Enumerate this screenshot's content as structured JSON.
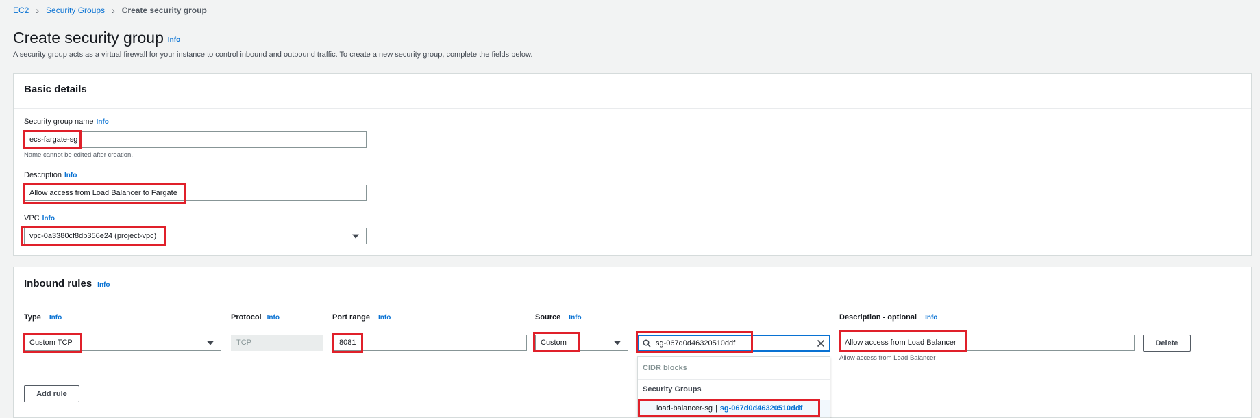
{
  "breadcrumb": {
    "items": [
      "EC2",
      "Security Groups"
    ],
    "current": "Create security group"
  },
  "page": {
    "title": "Create security group",
    "info": "Info",
    "description": "A security group acts as a virtual firewall for your instance to control inbound and outbound traffic. To create a new security group, complete the fields below."
  },
  "basic": {
    "title": "Basic details",
    "name_label": "Security group name",
    "name_value": "ecs-fargate-sg",
    "name_hint": "Name cannot be edited after creation.",
    "desc_label": "Description",
    "desc_value": "Allow access from Load Balancer to Fargate",
    "vpc_label": "VPC",
    "vpc_value": "vpc-0a3380cf8db356e24 (project-vpc)",
    "info": "Info"
  },
  "inbound": {
    "title": "Inbound rules",
    "info": "Info",
    "columns": {
      "type": "Type",
      "protocol": "Protocol",
      "port": "Port range",
      "source": "Source",
      "desc": "Description - optional"
    },
    "rule": {
      "type": "Custom TCP",
      "protocol": "TCP",
      "port": "8081",
      "source": "Custom",
      "search": "sg-067d0d46320510ddf",
      "desc": "Allow access from Load Balancer",
      "desc_hint": "Allow access from Load Balancer"
    },
    "delete_label": "Delete",
    "add_rule_label": "Add rule",
    "dropdown": {
      "cidr_header": "CIDR blocks",
      "sg_header": "Security Groups",
      "option_name": "load-balancer-sg",
      "option_sep": "|",
      "option_id": "sg-067d0d46320510ddf"
    }
  },
  "colors": {
    "accent": "#0972d3",
    "highlight": "#e0202a",
    "background": "#f2f3f3"
  }
}
